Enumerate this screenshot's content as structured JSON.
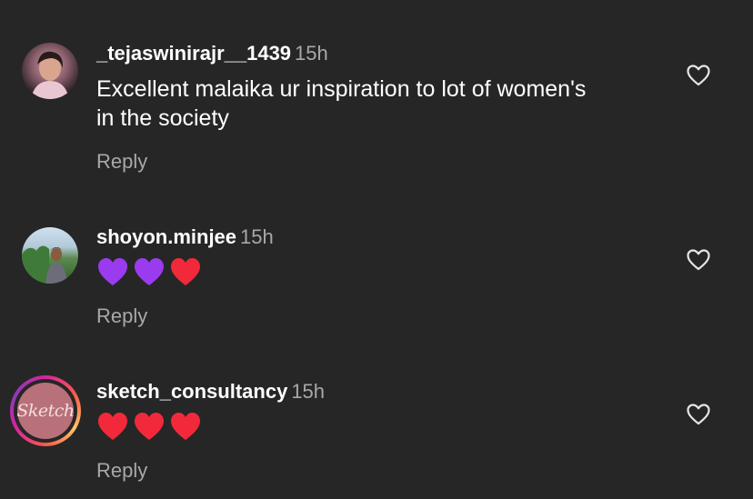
{
  "comments": [
    {
      "username": "_tejaswinirajr__1439",
      "time": "15h",
      "text": "Excellent malaika ur inspiration to lot of women's in the society",
      "reply_label": "Reply",
      "avatar_icon": "user-photo"
    },
    {
      "username": "shoyon.minjee",
      "time": "15h",
      "emojis": [
        "purple-heart",
        "purple-heart",
        "red-heart"
      ],
      "reply_label": "Reply",
      "avatar_icon": "user-photo"
    },
    {
      "username": "sketch_consultancy",
      "time": "15h",
      "emojis": [
        "red-heart",
        "red-heart",
        "red-heart"
      ],
      "reply_label": "Reply",
      "avatar_icon": "brand-logo",
      "logo_text": "Sketch"
    }
  ],
  "colors": {
    "background": "#262626",
    "secondary_text": "#a8a8a8",
    "purple_heart": "#9b3bf0",
    "red_heart": "#f2293b"
  }
}
